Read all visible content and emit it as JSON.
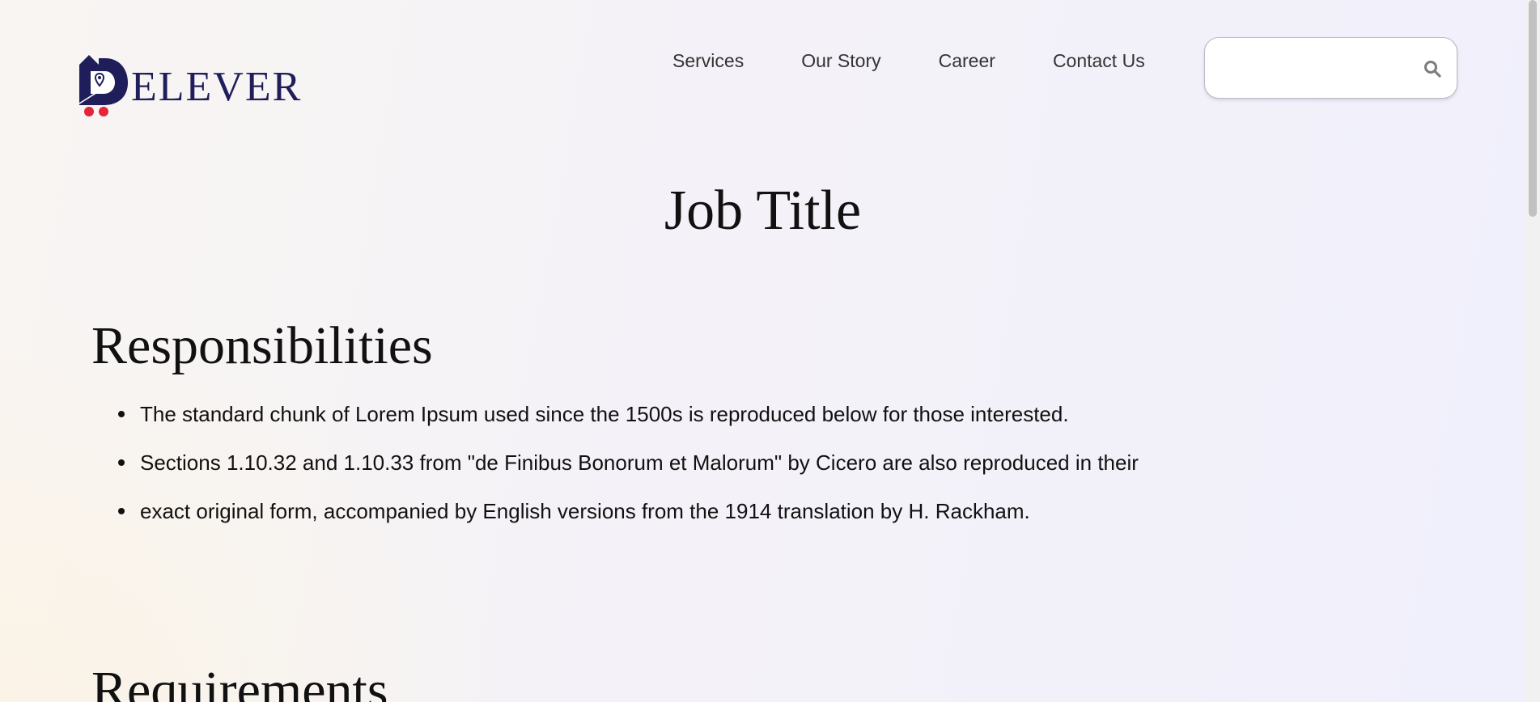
{
  "header": {
    "logo_text": "ELEVER",
    "nav": [
      {
        "label": "Services"
      },
      {
        "label": "Our Story"
      },
      {
        "label": "Career"
      },
      {
        "label": "Contact Us"
      }
    ],
    "search": {
      "value": "",
      "placeholder": "",
      "icon": "search-icon"
    }
  },
  "main": {
    "job_title": "Job Title",
    "responsibilities": {
      "heading": "Responsibilities",
      "items": [
        "The standard chunk of Lorem Ipsum used since the 1500s is reproduced below for those interested.",
        "Sections 1.10.32 and 1.10.33 from \"de Finibus Bonorum et Malorum\" by Cicero are also reproduced in their",
        "exact original form, accompanied by English versions from the 1914 translation by H. Rackham."
      ]
    },
    "requirements": {
      "heading": "Requirements"
    }
  },
  "colors": {
    "brand_navy": "#1f1e5a",
    "brand_red": "#e3243b",
    "text": "#111111"
  }
}
